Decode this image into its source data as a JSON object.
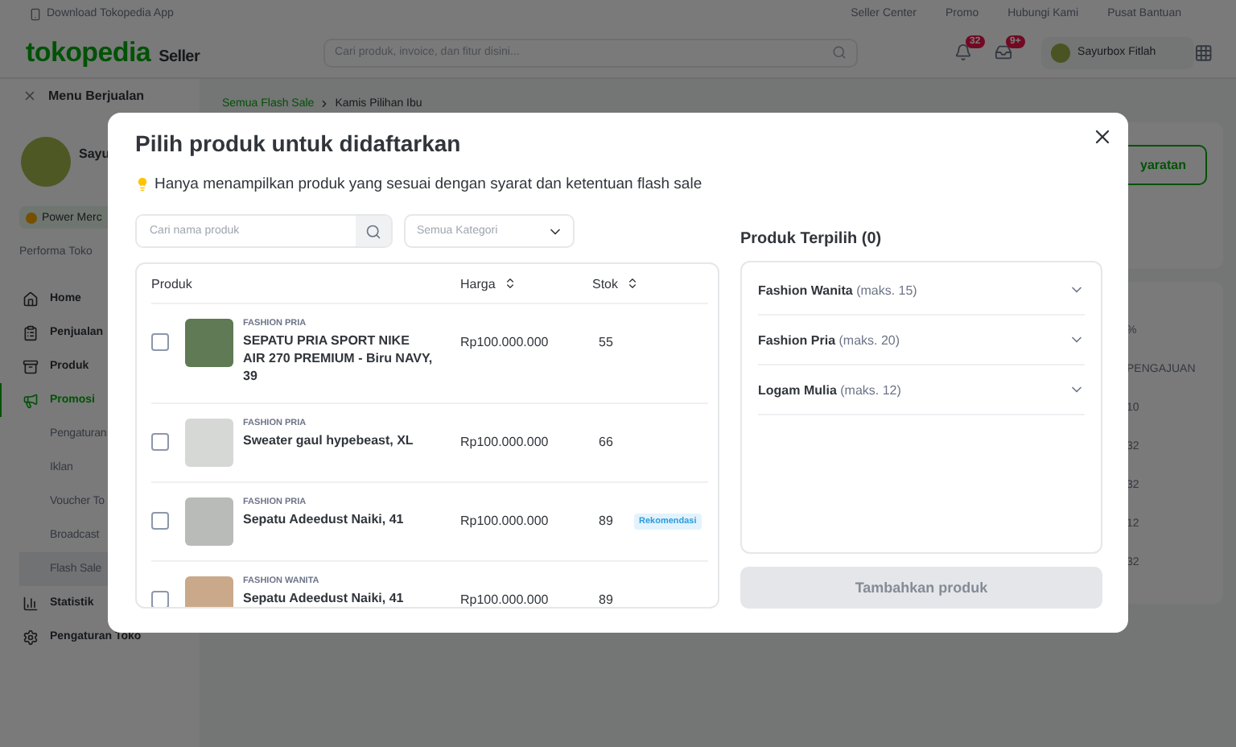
{
  "top_bar": {
    "app_link": "Download Tokopedia App",
    "links": [
      "Seller Center",
      "Promo",
      "Hubungi Kami",
      "Pusat Bantuan"
    ]
  },
  "header": {
    "logo": "tokopedia",
    "logo_suffix": "Seller",
    "search": {
      "placeholder": "Cari produk, invoice, dan fitur disini..."
    },
    "notifications": [
      {
        "kind": "bell",
        "count": "32"
      },
      {
        "kind": "inbox",
        "count": "9+"
      }
    ],
    "user": "Sayurbox Fitlah"
  },
  "sidebar": {
    "title": "Menu Berjualan",
    "shop_name": "Sayu",
    "badge": "Power Merc",
    "section": "Performa Toko",
    "items": [
      {
        "kind": "home",
        "label": "Home",
        "selected": false
      },
      {
        "kind": "clipboard",
        "label": "Penjualan",
        "selected": false
      },
      {
        "kind": "box",
        "label": "Produk",
        "selected": false
      },
      {
        "kind": "megaphone",
        "label": "Promosi",
        "selected": true,
        "children": [
          {
            "label": "Pengaturan",
            "selected": false
          },
          {
            "label": "Iklan",
            "selected": false
          },
          {
            "label": "Voucher To",
            "selected": false
          },
          {
            "label": "Broadcast",
            "selected": false
          },
          {
            "label": "Flash Sale",
            "selected": true
          }
        ]
      },
      {
        "kind": "chart",
        "label": "Statistik",
        "selected": false
      },
      {
        "kind": "gear",
        "label": "Pengaturan Toko",
        "selected": false
      }
    ]
  },
  "breadcrumb": [
    "Semua Flash Sale",
    "Kamis Pilihan Ibu"
  ],
  "background_panel": {
    "button": "yaratan",
    "column_1": "%",
    "column_2": "PENGAJUAN",
    "values": [
      "10",
      "32",
      "32",
      "12",
      "32"
    ]
  },
  "modal": {
    "title": "Pilih produk untuk didaftarkan",
    "hint": "Hanya menampilkan produk yang sesuai dengan syarat dan ketentuan flash sale",
    "search": {
      "placeholder": "Cari nama produk"
    },
    "category": {
      "placeholder": "Semua Kategori"
    },
    "columns": [
      "Produk",
      "Harga",
      "Stok"
    ],
    "products": [
      {
        "category": "FASHION PRIA",
        "name": "SEPATU PRIA SPORT NIKE AIR 270 PREMIUM - Biru NAVY, 39",
        "price": "Rp100.000.000",
        "stock": "55",
        "checked": false
      },
      {
        "category": "FASHION PRIA",
        "name": "Sweater gaul hypebeast, XL",
        "price": "Rp100.000.000",
        "stock": "66",
        "checked": false
      },
      {
        "category": "FASHION PRIA",
        "name": "Sepatu Adeedust Naiki, 41",
        "price": "Rp100.000.000",
        "stock": "89",
        "checked": false,
        "badge": "Rekomendasi"
      },
      {
        "category": "FASHION WANITA",
        "name": "Sepatu Adeedust Naiki, 41",
        "price": "Rp100.000.000",
        "stock": "89",
        "checked": false
      }
    ],
    "selected_title": "Produk Terpilih (0)",
    "groups": [
      {
        "name": "Fashion Wanita",
        "limit": "(maks. 15)",
        "expanded": false
      },
      {
        "name": "Fashion Pria",
        "limit": "(maks. 20)",
        "expanded": false
      },
      {
        "name": "Logam Mulia",
        "limit": "(maks. 12)",
        "expanded": false
      }
    ],
    "submit": {
      "label": "Tambahkan produk",
      "disabled": true
    }
  }
}
